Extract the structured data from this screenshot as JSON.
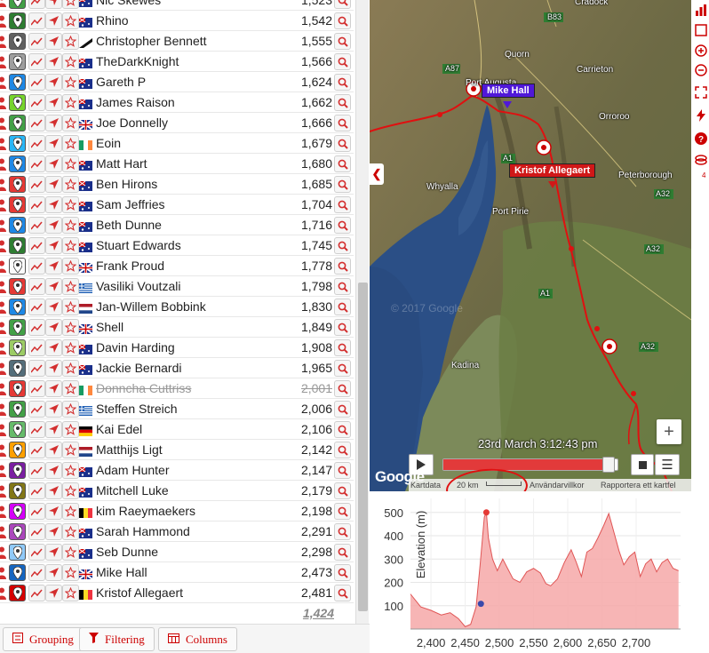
{
  "leaderboard": {
    "rows": [
      {
        "name": "Nic Skewes",
        "value": "1,523",
        "pin": "#43a047",
        "flag": "au"
      },
      {
        "name": "Rhino",
        "value": "1,542",
        "pin": "#2e7d32",
        "flag": "au"
      },
      {
        "name": "Christopher Bennett",
        "value": "1,555",
        "pin": "#616161",
        "flag": "other"
      },
      {
        "name": "TheDarkKnight",
        "value": "1,566",
        "pin": "#9e9e9e",
        "flag": "au"
      },
      {
        "name": "Gareth P",
        "value": "1,624",
        "pin": "#1e88e5",
        "flag": "au"
      },
      {
        "name": "James Raison",
        "value": "1,662",
        "pin": "#76d42c",
        "flag": "au"
      },
      {
        "name": "Joe Donnelly",
        "value": "1,666",
        "pin": "#43a047",
        "flag": "gb"
      },
      {
        "name": "Eoin",
        "value": "1,679",
        "pin": "#29b6f6",
        "flag": "ie"
      },
      {
        "name": "Matt Hart",
        "value": "1,680",
        "pin": "#1e88e5",
        "flag": "au"
      },
      {
        "name": "Ben Hirons",
        "value": "1,685",
        "pin": "#e53935",
        "flag": "au"
      },
      {
        "name": "Sam Jeffries",
        "value": "1,704",
        "pin": "#e53935",
        "flag": "au"
      },
      {
        "name": "Beth Dunne",
        "value": "1,716",
        "pin": "#1e88e5",
        "flag": "au"
      },
      {
        "name": "Stuart Edwards",
        "value": "1,745",
        "pin": "#2e7d32",
        "flag": "au"
      },
      {
        "name": "Frank Proud",
        "value": "1,778",
        "pin": "#fafafa",
        "flag": "gb"
      },
      {
        "name": "Vasiliki Voutzali",
        "value": "1,798",
        "pin": "#e53935",
        "flag": "gr"
      },
      {
        "name": "Jan-Willem Bobbink",
        "value": "1,830",
        "pin": "#1e88e5",
        "flag": "nl"
      },
      {
        "name": "Shell",
        "value": "1,849",
        "pin": "#43a047",
        "flag": "gb"
      },
      {
        "name": "Davin Harding",
        "value": "1,908",
        "pin": "#9ccc65",
        "flag": "au"
      },
      {
        "name": "Jackie Bernardi",
        "value": "1,965",
        "pin": "#546e7a",
        "flag": "au"
      },
      {
        "name": "Donncha Cuttriss",
        "value": "2,001",
        "pin": "#e53935",
        "flag": "ie",
        "struck": true
      },
      {
        "name": "Steffen Streich",
        "value": "2,006",
        "pin": "#43a047",
        "flag": "gr"
      },
      {
        "name": "Kai Edel",
        "value": "2,106",
        "pin": "#66bb6a",
        "flag": "de"
      },
      {
        "name": "Matthijs Ligt",
        "value": "2,142",
        "pin": "#ffa000",
        "flag": "nl"
      },
      {
        "name": "Adam Hunter",
        "value": "2,147",
        "pin": "#7b1fa2",
        "flag": "au"
      },
      {
        "name": "Mitchell Luke",
        "value": "2,179",
        "pin": "#827717",
        "flag": "au"
      },
      {
        "name": "kim Raeymaekers",
        "value": "2,198",
        "pin": "#d500f9",
        "flag": "be"
      },
      {
        "name": "Sarah Hammond",
        "value": "2,291",
        "pin": "#ab47bc",
        "flag": "au"
      },
      {
        "name": "Seb Dunne",
        "value": "2,298",
        "pin": "#90caf9",
        "flag": "au"
      },
      {
        "name": "Mike Hall",
        "value": "2,473",
        "pin": "#1565c0",
        "flag": "gb"
      },
      {
        "name": "Kristof Allegaert",
        "value": "2,481",
        "pin": "#d50000",
        "flag": "be"
      }
    ],
    "total": "1,424"
  },
  "toolbar": {
    "grouping": "Grouping",
    "filtering": "Filtering",
    "columns": "Columns"
  },
  "map": {
    "places": {
      "cradock": "Cradock",
      "b83": "B83",
      "quorn": "Quorn",
      "carrieton": "Carrieton",
      "a87": "A87",
      "port_augusta": "Port Augusta",
      "orroroo": "Orroroo",
      "a1_top": "A1",
      "whyalla": "Whyalla",
      "peterborough": "Peterborough",
      "a32_1": "A32",
      "port_pirie": "Port Pirie",
      "a32_2": "A32",
      "a1_mid": "A1",
      "watermark": "© 2017 Google",
      "a32_3": "A32",
      "kadina": "Kadina"
    },
    "markers": {
      "mike": "Mike Hall",
      "kristof": "Kristof Allegaert"
    },
    "timestamp": "23rd March 3:12:43 pm",
    "slider_fraction": 0.985,
    "google": "Google",
    "attribution": {
      "kartdata": "Kartdata",
      "scale": "20 km",
      "terms": "Användarvillkor",
      "report": "Rapportera ett kartfel"
    }
  },
  "right_panel": {
    "layer_count": "4"
  },
  "chart_data": {
    "type": "area",
    "ylabel": "Elevation (m)",
    "xlabel": "",
    "xlim": [
      2370,
      2765
    ],
    "ylim": [
      0,
      560
    ],
    "x_ticks": [
      "2,400",
      "2,450",
      "2,500",
      "2,550",
      "2,600",
      "2,650",
      "2,700"
    ],
    "y_ticks": [
      "100",
      "200",
      "300",
      "400",
      "500"
    ],
    "x": [
      2370,
      2385,
      2400,
      2415,
      2428,
      2440,
      2450,
      2458,
      2466,
      2472,
      2478,
      2481,
      2484,
      2490,
      2497,
      2505,
      2512,
      2520,
      2530,
      2540,
      2550,
      2560,
      2568,
      2575,
      2585,
      2595,
      2605,
      2612,
      2620,
      2628,
      2636,
      2644,
      2652,
      2660,
      2668,
      2675,
      2682,
      2690,
      2698,
      2706,
      2714,
      2722,
      2730,
      2738,
      2746,
      2754,
      2762
    ],
    "values": [
      150,
      95,
      80,
      60,
      70,
      45,
      10,
      20,
      95,
      280,
      480,
      500,
      390,
      300,
      250,
      300,
      260,
      215,
      200,
      245,
      260,
      240,
      195,
      185,
      215,
      285,
      340,
      290,
      225,
      330,
      345,
      390,
      440,
      495,
      410,
      335,
      275,
      310,
      330,
      225,
      280,
      300,
      245,
      285,
      300,
      260,
      250
    ],
    "markers": [
      {
        "label": "Kristof Allegaert",
        "x": 2481,
        "y": 500,
        "color": "#e53935"
      },
      {
        "label": "Mike Hall",
        "x": 2473,
        "y": 108,
        "color": "#3949ab"
      }
    ],
    "grid": true
  }
}
